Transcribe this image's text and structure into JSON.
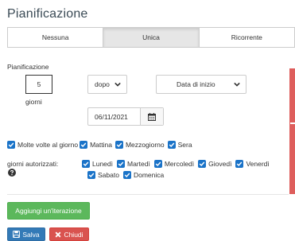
{
  "title": "Pianificazione",
  "modes": [
    "Nessuna",
    "Unica",
    "Ricorrente"
  ],
  "panel": {
    "label": "Pianificazione",
    "amount": "5",
    "unit": "giorni",
    "direction": "dopo",
    "reference": "Data di inizio",
    "date": "06/11/2021"
  },
  "times": {
    "multiple_label": "Molte volte al giorno",
    "options": [
      "Mattina",
      "Mezzogiorno",
      "Sera"
    ]
  },
  "days": {
    "label": "giorni autorizzati:",
    "row1": [
      "Lunedì",
      "Martedì",
      "Mercoledì",
      "Giovedì",
      "Venerdì"
    ],
    "row2": [
      "Sabato",
      "Domenica"
    ]
  },
  "buttons": {
    "add": "Aggiungi un'iterazione",
    "save": "Salva",
    "close": "Chiudi"
  },
  "colors": {
    "checkbox": "#1a73c8",
    "add_button": "#5cb85c",
    "save_button": "#337ab7",
    "close_button": "#d9534f",
    "side_strip": "#de5e5c"
  }
}
